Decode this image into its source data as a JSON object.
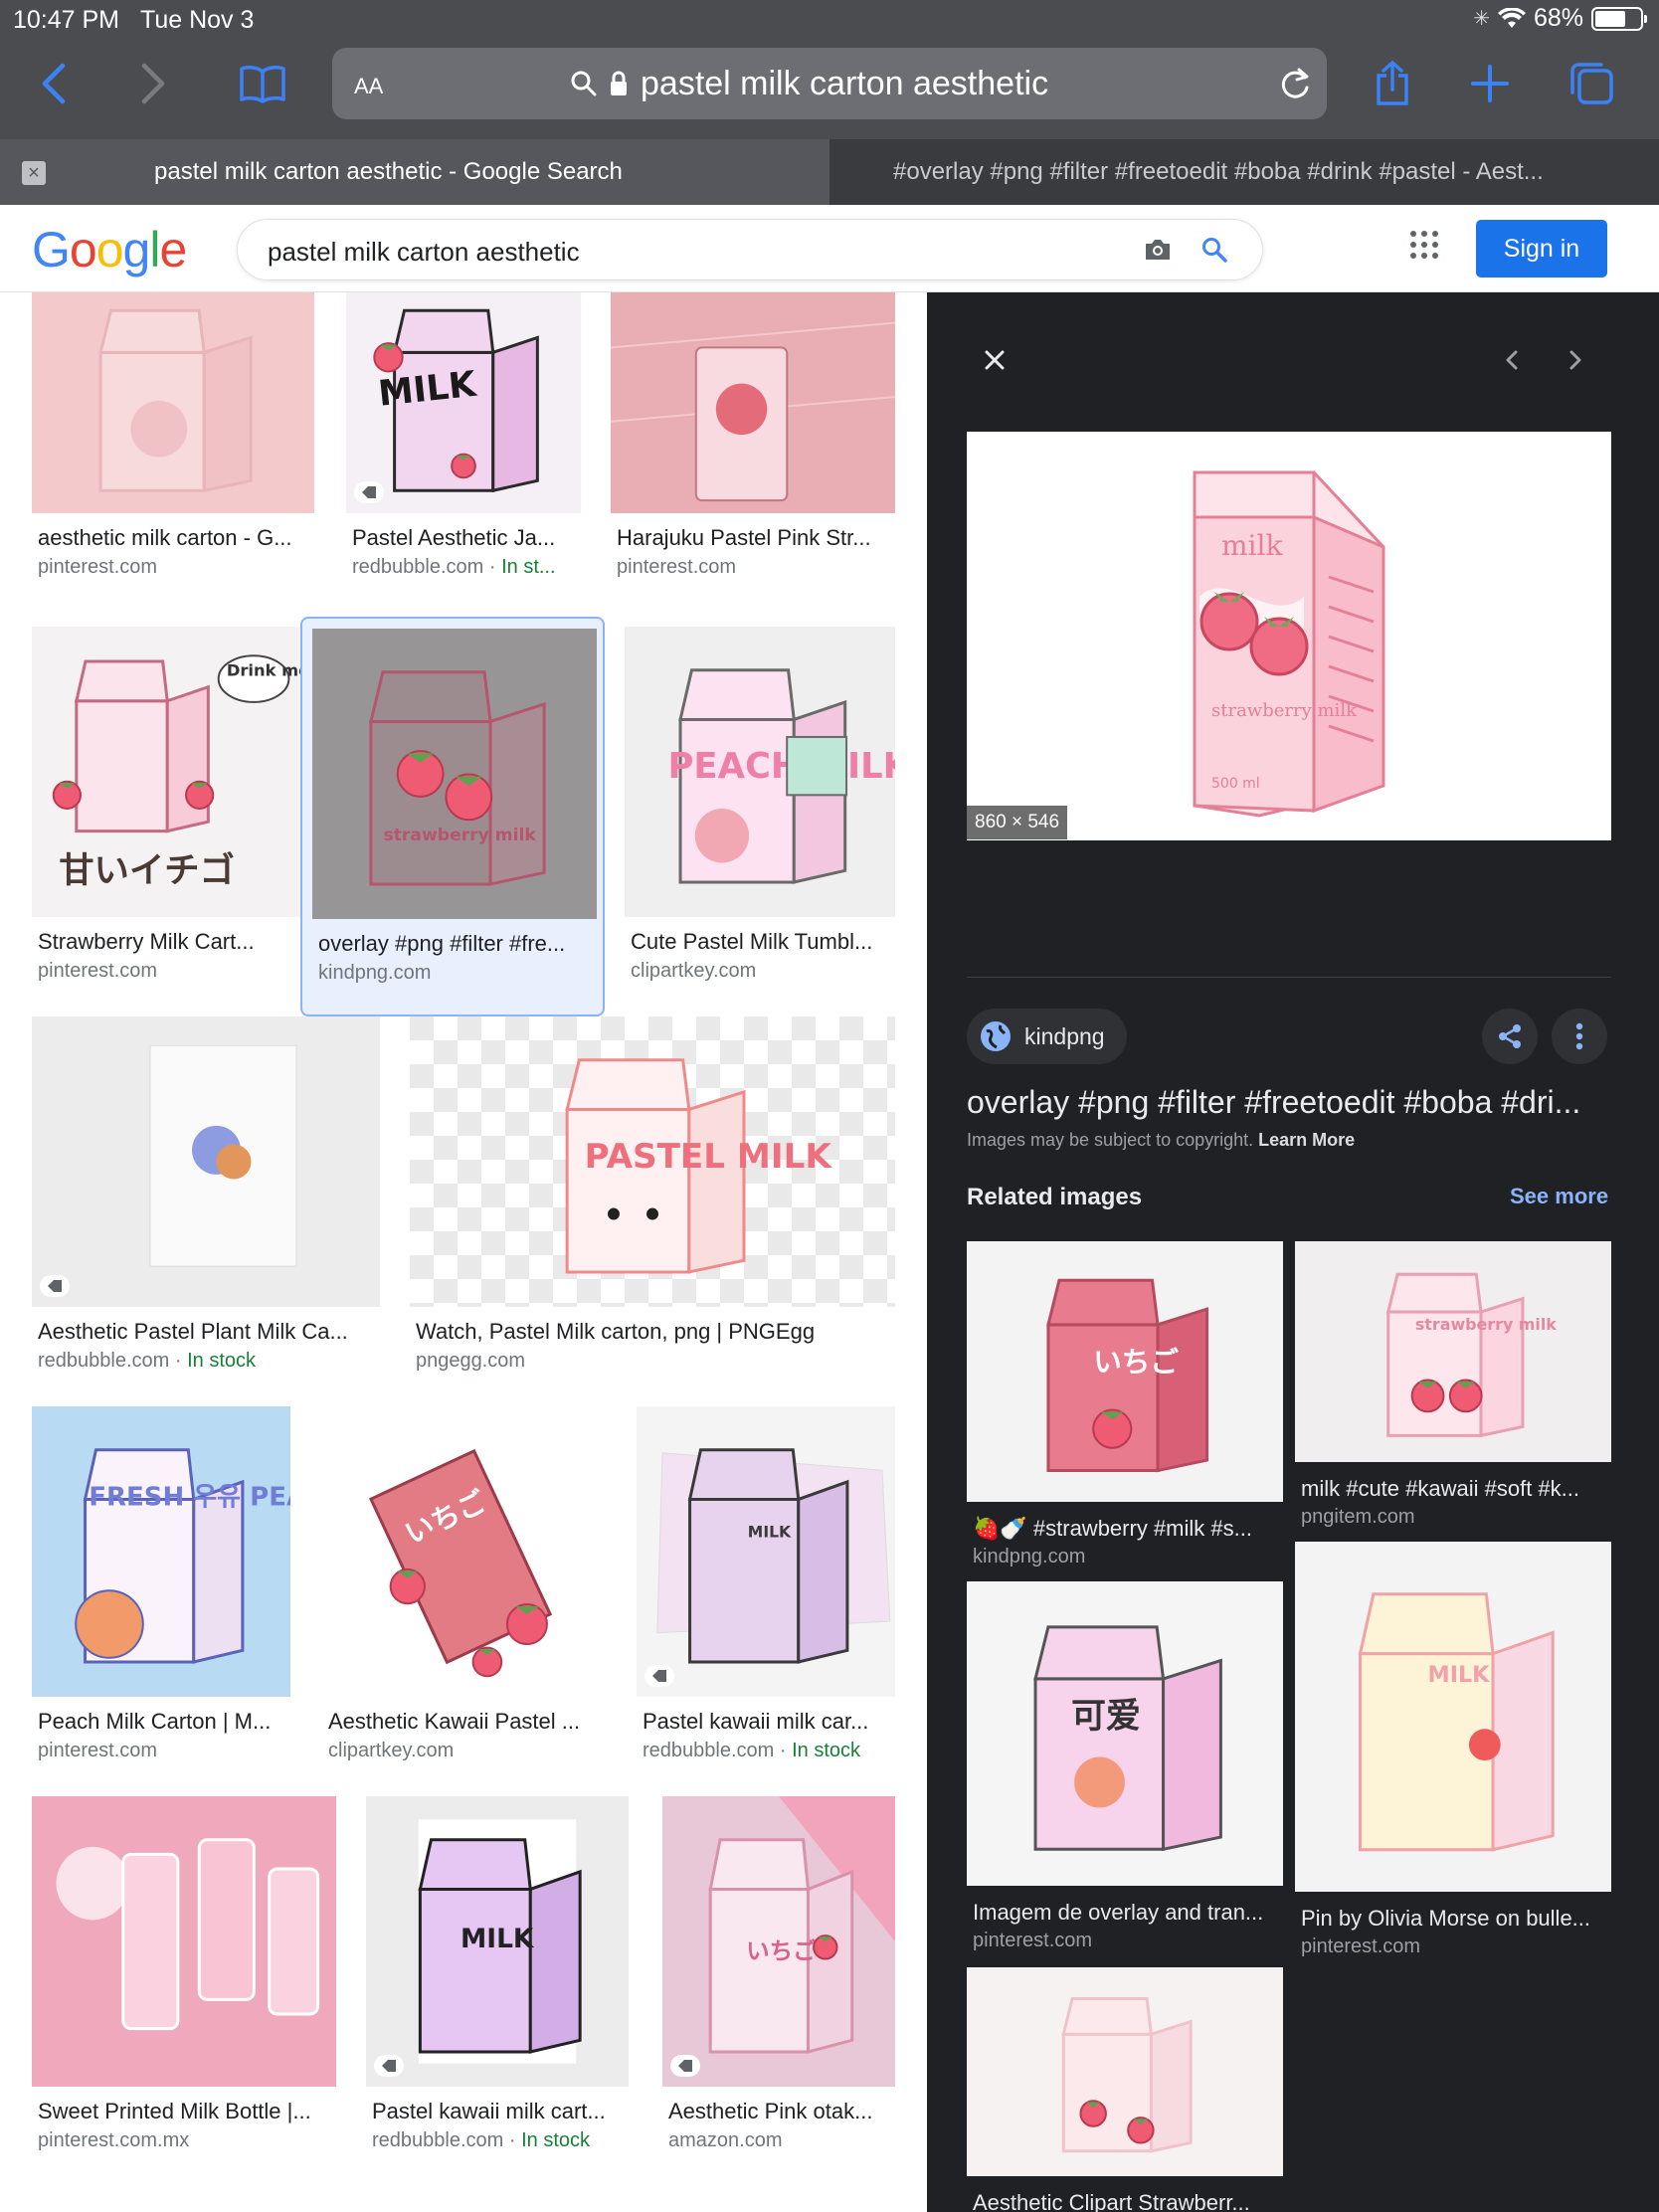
{
  "status_bar": {
    "time": "10:47 PM",
    "date": "Tue Nov 3",
    "battery": "68%",
    "battery_level": 0.68
  },
  "browser": {
    "text_size_button": "AA",
    "url": "pastel milk carton aesthetic",
    "tabs": [
      {
        "label": "pastel milk carton aesthetic - Google Search",
        "active": true
      },
      {
        "label": "#overlay #png #filter #freetoedit #boba #drink #pastel - Aest...",
        "active": false
      }
    ]
  },
  "google": {
    "logo": "Google",
    "search_query": "pastel milk carton aesthetic",
    "sign_in_label": "Sign in",
    "accent": "#1a73e8"
  },
  "results": [
    {
      "title": "aesthetic milk carton - G...",
      "source": "pinterest.com",
      "stock": ""
    },
    {
      "title": "Pastel Aesthetic Ja...",
      "source": "redbubble.com · ",
      "stock": "In st..."
    },
    {
      "title": "Harajuku Pastel Pink Str...",
      "source": "pinterest.com",
      "stock": ""
    },
    {
      "title": "Strawberry Milk Cart...",
      "source": "pinterest.com",
      "stock": ""
    },
    {
      "title": "overlay #png #filter #fre...",
      "source": "kindpng.com",
      "stock": ""
    },
    {
      "title": "Cute Pastel Milk Tumbl...",
      "source": "clipartkey.com",
      "stock": ""
    },
    {
      "title": "Aesthetic Pastel Plant Milk Ca...",
      "source": "redbubble.com · ",
      "stock": "In stock"
    },
    {
      "title": "Watch, Pastel Milk carton, png | PNGEgg",
      "source": "pngegg.com",
      "stock": ""
    },
    {
      "title": "Peach Milk Carton | M...",
      "source": "pinterest.com",
      "stock": ""
    },
    {
      "title": "Aesthetic Kawaii Pastel ...",
      "source": "clipartkey.com",
      "stock": ""
    },
    {
      "title": "Pastel kawaii milk car...",
      "source": "redbubble.com · ",
      "stock": "In stock"
    },
    {
      "title": "Sweet Printed Milk Bottle |...",
      "source": "pinterest.com.mx",
      "stock": ""
    },
    {
      "title": "Pastel kawaii milk cart...",
      "source": "redbubble.com · ",
      "stock": "In stock"
    },
    {
      "title": "Aesthetic Pink otak...",
      "source": "amazon.com",
      "stock": ""
    }
  ],
  "thumb_text": {
    "milk": "MILK",
    "strawberry_milk": "strawberry milk",
    "drink_me": "Drink me.",
    "amai_ichigo": "甘いイチゴ",
    "peach_milk": "PEACH MILK",
    "pastel_milk": "PASTEL MILK",
    "fresh_peach": "FRESH 우유 PEACH",
    "ichigo": "いちご",
    "kawaii": "可爱"
  },
  "panel": {
    "dimensions": "860 × 546",
    "source_name": "kindpng",
    "title": "overlay #png #filter #freetoedit #boba #dri...",
    "copyright": "Images may be subject to copyright.",
    "learn_more": "Learn More",
    "related_heading": "Related images",
    "see_more": "See more",
    "preview_label_top": "milk",
    "preview_label_mid": "strawberry milk",
    "preview_volume": "500 ml",
    "related": [
      {
        "title": "🍓🍼 #strawberry #milk #s...",
        "source": "kindpng.com"
      },
      {
        "title": "milk #cute #kawaii #soft #k...",
        "source": "pngitem.com"
      },
      {
        "title": "Imagem de overlay and tran...",
        "source": "pinterest.com"
      },
      {
        "title": "Pin by Olivia Morse on bulle...",
        "source": "pinterest.com"
      },
      {
        "title": "Aesthetic Clipart Strawberr...",
        "source": ""
      }
    ]
  }
}
